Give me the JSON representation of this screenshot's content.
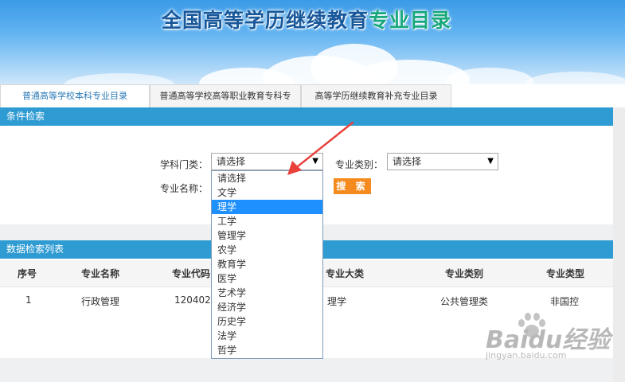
{
  "header": {
    "title_main": "全国高等学历继续教育",
    "title_accent": "专业目录"
  },
  "tabs": [
    {
      "label": "普通高等学校本科专业目录",
      "active": true
    },
    {
      "label": "普通高等学校高等职业教育专科专",
      "active": false
    },
    {
      "label": "高等学历继续教育补充专业目录",
      "active": false
    }
  ],
  "filter": {
    "section_title": "条件检索",
    "discipline_label": "学科门类：",
    "discipline_value": "请选择",
    "category_label": "专业类别：",
    "category_value": "请选择",
    "name_label": "专业名称：",
    "search_button": "搜 索",
    "dropdown_options": [
      "请选择",
      "文学",
      "理学",
      "工学",
      "管理学",
      "农学",
      "教育学",
      "医学",
      "艺术学",
      "经济学",
      "历史学",
      "法学",
      "哲学"
    ],
    "highlighted_option": "理学"
  },
  "results": {
    "section_title": "数据检索列表",
    "columns": [
      "序号",
      "专业名称",
      "专业代码",
      "专业大类",
      "专业类别",
      "专业类型"
    ],
    "rows": [
      {
        "index": "1",
        "name": "行政管理",
        "code": "120402",
        "major_class": "理学",
        "category": "公共管理类",
        "type": "非国控"
      }
    ]
  },
  "watermark": {
    "text": "Baidu经验",
    "url": "jingyan.baidu.com"
  },
  "colors": {
    "section_bar": "#2e9bd2",
    "search_button": "#f58b1f",
    "highlight": "#1e90ff",
    "annotation_arrow": "#e8403a"
  }
}
